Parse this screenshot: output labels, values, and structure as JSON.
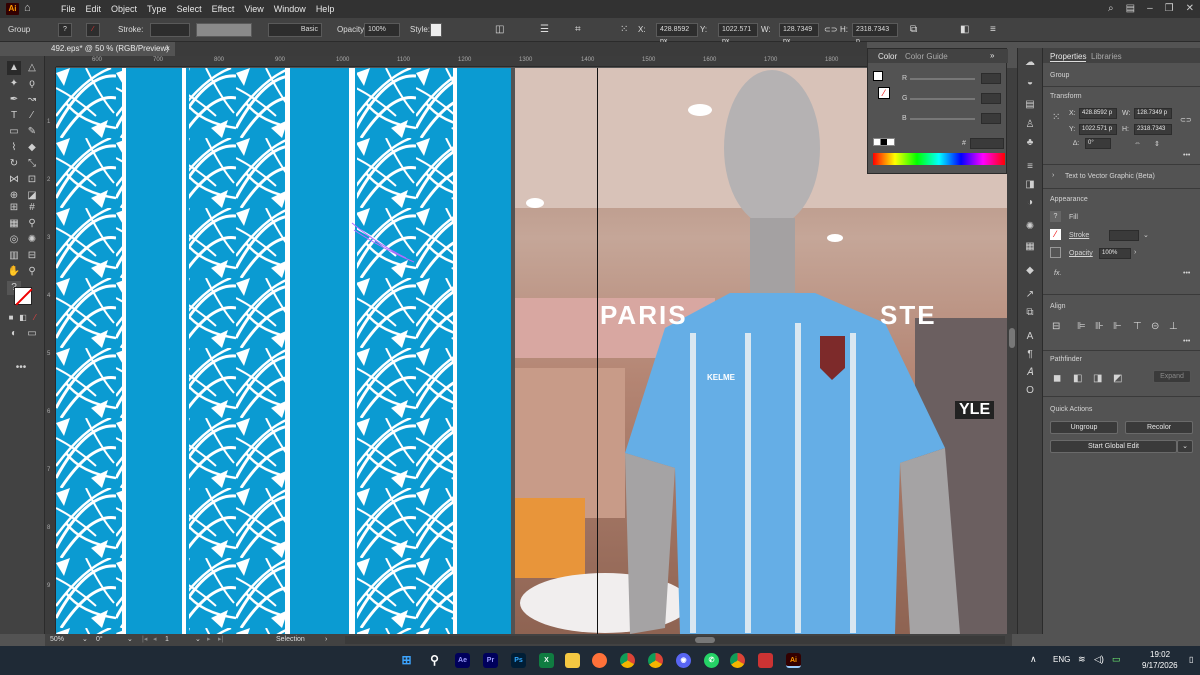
{
  "app": {
    "logo": "Ai",
    "home_icon": "home-icon"
  },
  "menu": [
    "File",
    "Edit",
    "Object",
    "Type",
    "Select",
    "Effect",
    "View",
    "Window",
    "Help"
  ],
  "control": {
    "selection": "Group",
    "stroke_label": "Stroke:",
    "brush": "Basic",
    "opacity_label": "Opacity:",
    "opacity": "100%",
    "style_label": "Style:",
    "x_label": "X:",
    "x": "428.8592 px",
    "y_label": "Y:",
    "y": "1022.571 px",
    "w_label": "W:",
    "w": "128.7349 px",
    "h_label": "H:",
    "h": "2318.7343 p"
  },
  "document": {
    "tab": "492.eps* @ 50 % (RGB/Preview)",
    "close": "×"
  },
  "ruler_h": [
    "600",
    "700",
    "800",
    "900",
    "1000",
    "1100",
    "1200",
    "1300",
    "1400",
    "1500",
    "1600",
    "1700",
    "1800"
  ],
  "ruler_v": [
    "1",
    "2",
    "3",
    "4",
    "5",
    "6",
    "7",
    "8",
    "9"
  ],
  "color_panel": {
    "tabs": [
      "Color",
      "Color Guide"
    ],
    "channels": [
      "R",
      "G",
      "B"
    ],
    "hash": "#"
  },
  "properties": {
    "tabs": [
      "Properties",
      "Libraries"
    ],
    "selection": "Group",
    "transform_title": "Transform",
    "x_label": "X:",
    "x": "428.8592 p",
    "y_label": "Y:",
    "y": "1022.571 p",
    "w_label": "W:",
    "w": "128.7349 p",
    "h_label": "H:",
    "h": "2318.7343",
    "angle_label": "∆:",
    "angle": "0°",
    "text_to_vector": "Text to Vector Graphic (Beta)",
    "appearance_title": "Appearance",
    "fill": "Fill",
    "stroke": "Stroke",
    "opacity_label": "Opacity",
    "opacity": "100%",
    "fx": "fx.",
    "align_title": "Align",
    "pathfinder_title": "Pathfinder",
    "expand": "Expand",
    "quick_actions_title": "Quick Actions",
    "ungroup": "Ungroup",
    "recolor": "Recolor",
    "global_edit": "Start Global Edit"
  },
  "status": {
    "zoom": "50%",
    "rotation": "0°",
    "artboard": "1",
    "tool": "Selection"
  },
  "photo_text": {
    "store_sign": "PARIS",
    "store_sign_right": "STE",
    "side_sign": "YLE",
    "brand": "KELME"
  },
  "taskbar": {
    "apps": [
      "Ae",
      "Pr",
      "Ps",
      "X",
      "Ai"
    ],
    "lang": "ENG",
    "time": "19:02",
    "date": "9/17/2026"
  },
  "colors": {
    "pattern_blue": "#0b9bd2",
    "ai_orange": "#ff9a00"
  }
}
